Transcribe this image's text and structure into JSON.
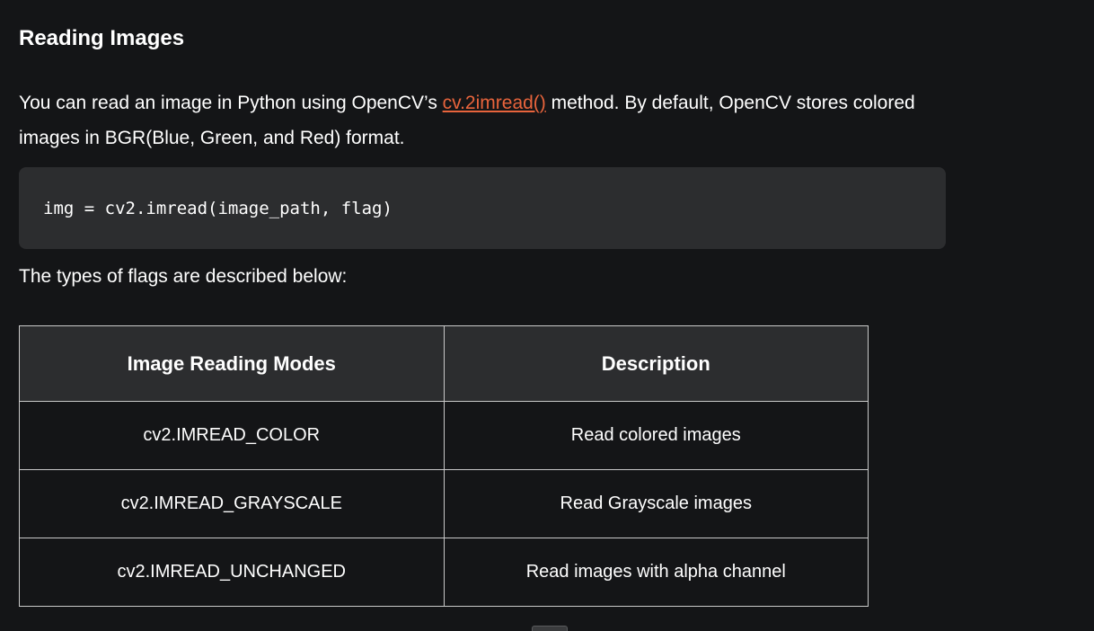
{
  "article": {
    "heading": "Reading Images",
    "intro_before": "You can read an image in Python using OpenCV’s ",
    "intro_link": "cv.2imread()",
    "intro_after": " method. By default, OpenCV stores colored images in BGR(Blue, Green, and Red) format.",
    "code": "img = cv2.imread(image_path, flag)",
    "flags_intro": "The types of flags are described below:"
  },
  "table": {
    "headers": [
      "Image Reading Modes",
      "Description"
    ],
    "rows": [
      [
        "cv2.IMREAD_COLOR",
        "Read colored images"
      ],
      [
        "cv2.IMREAD_GRAYSCALE",
        "Read Grayscale images"
      ],
      [
        "cv2.IMREAD_UNCHANGED",
        "Read images with alpha channel"
      ]
    ]
  },
  "colors": {
    "background": "#141517",
    "code_background": "#2c2d2f",
    "link": "#e8643c"
  }
}
